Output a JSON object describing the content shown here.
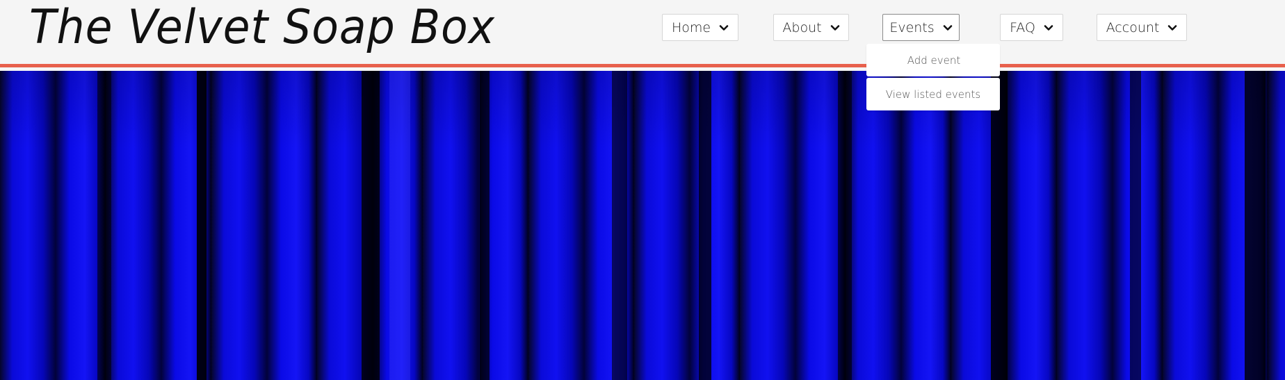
{
  "site": {
    "title": "The Velvet Soap Box"
  },
  "nav": {
    "items": [
      {
        "label": "Home",
        "icon": "chevron-down-icon"
      },
      {
        "label": "About",
        "icon": "chevron-down-icon"
      },
      {
        "label": "Events",
        "icon": "chevron-down-icon",
        "active": true
      },
      {
        "label": "FAQ",
        "icon": "chevron-down-icon"
      },
      {
        "label": "Account",
        "icon": "chevron-down-icon"
      }
    ],
    "events_menu": [
      {
        "label": "Add event"
      },
      {
        "label": "View listed events"
      }
    ]
  },
  "colors": {
    "accent_border": "#e8604c",
    "header_bg": "#f5f5f5",
    "curtain": "#1010f0"
  },
  "hero": {
    "image": "blue velvet curtain"
  }
}
